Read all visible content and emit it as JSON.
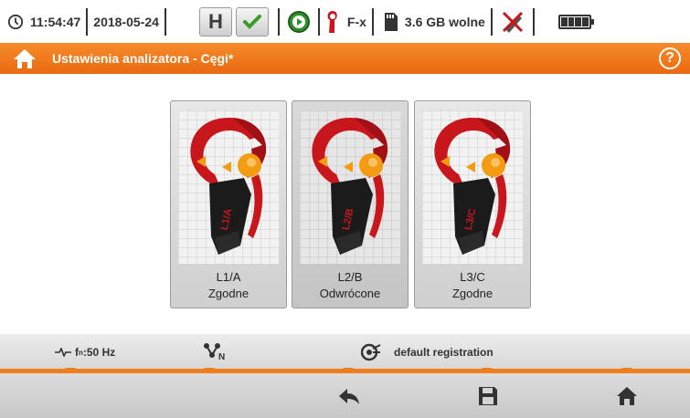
{
  "status_bar": {
    "time": "11:54:47",
    "date": "2018-05-24",
    "hold_label": "H",
    "clamp_mode": "F-x",
    "storage": "3.6 GB wolne"
  },
  "title_bar": {
    "title": "Ustawienia analizatora - Cęgi*",
    "help_label": "?"
  },
  "clamps": [
    {
      "phase": "L1/A",
      "direction": "Zgodne",
      "tag": "L1/A",
      "selected": false
    },
    {
      "phase": "L2/B",
      "direction": "Odwrócone",
      "tag": "L2/B",
      "selected": true
    },
    {
      "phase": "L3/C",
      "direction": "Zgodne",
      "tag": "L3/C",
      "selected": false
    }
  ],
  "info_bar": {
    "freq_prefix": "f",
    "freq_sub": "n",
    "freq_value": ":50 Hz",
    "registration": "default registration"
  },
  "colors": {
    "accent": "#f07e1d",
    "clamp_red": "#c8161d",
    "clamp_orange": "#f39c12",
    "ok_green": "#3a9a2a"
  },
  "icons": {
    "clock": "clock-icon",
    "hold": "hold-button",
    "ok": "checkmark-icon",
    "record": "play-circle-icon",
    "clamp": "clamp-icon",
    "sd": "sd-card-icon",
    "connection": "usb-off-icon",
    "battery": "battery-icon",
    "home": "home-icon",
    "help": "help-icon",
    "back": "back-arrow-icon",
    "save": "save-icon"
  }
}
